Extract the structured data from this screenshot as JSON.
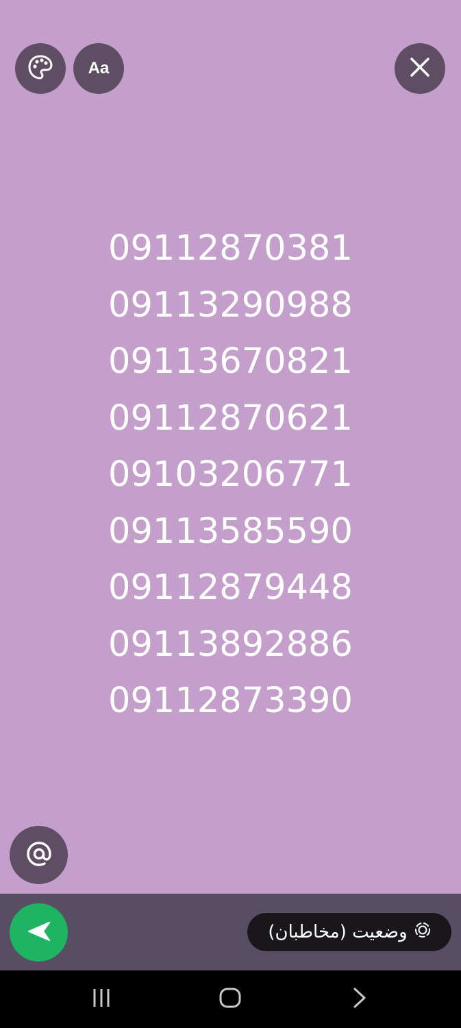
{
  "toolbar": {
    "font_label": "Aa"
  },
  "phone_numbers": [
    "09112870381",
    "09113290988",
    "09113670821",
    "09112870621",
    "09103206771",
    "09113585590",
    "09112879448",
    "09113892886",
    "09112873390"
  ],
  "status_pill": {
    "label": "وضعیت (مخاطبان)"
  },
  "colors": {
    "canvas_background": "#c49fcb",
    "button_background": "#5f4e63",
    "bottom_bar": "#574e63",
    "send_button": "#1fb463",
    "status_pill": "#1a171c"
  },
  "icons": {
    "palette": "palette-icon",
    "close": "close-icon",
    "mention": "at-sign-icon",
    "send": "send-arrow-icon",
    "status": "status-ring-icon",
    "nav_recents": "recents-icon",
    "nav_home": "home-icon",
    "nav_back": "back-chevron-icon"
  }
}
